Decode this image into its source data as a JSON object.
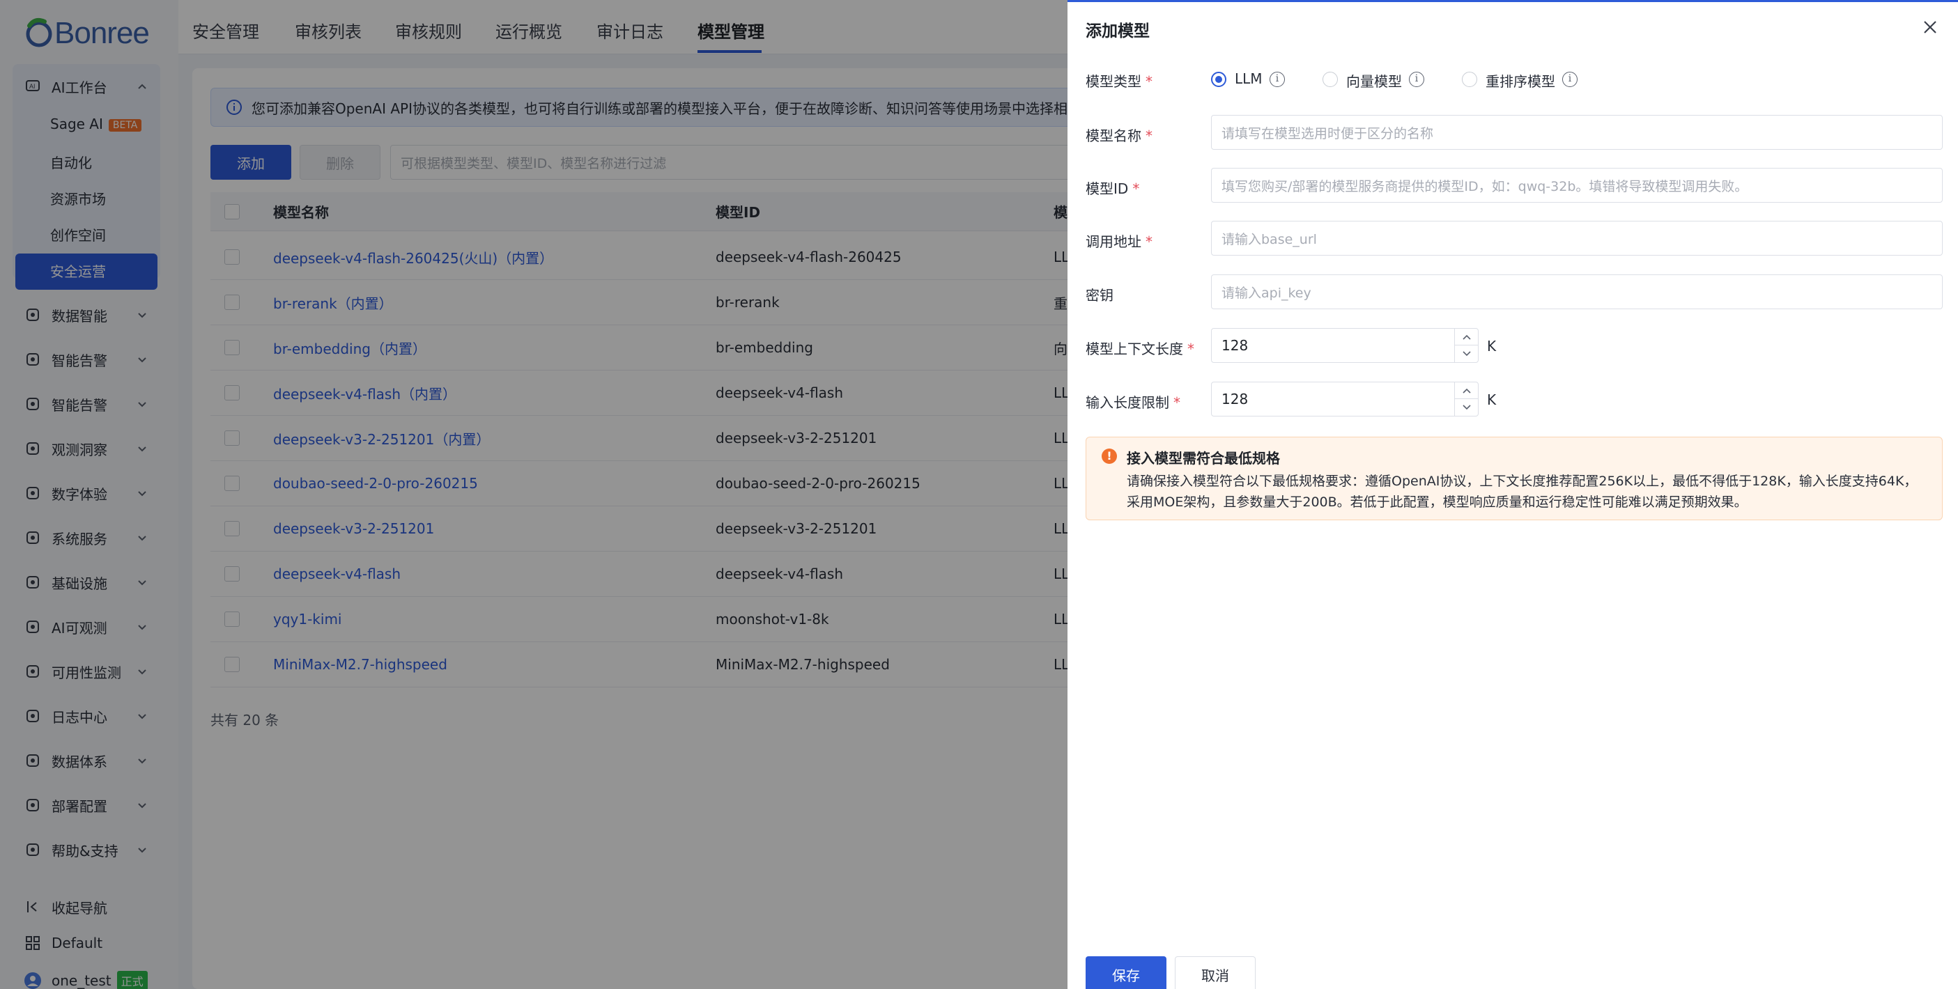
{
  "brand": {
    "logo_text": "Bonree"
  },
  "top_tabs": [
    {
      "label": "安全管理"
    },
    {
      "label": "审核列表"
    },
    {
      "label": "审核规则"
    },
    {
      "label": "运行概览"
    },
    {
      "label": "审计日志"
    },
    {
      "label": "模型管理",
      "active": true
    }
  ],
  "sidebar": {
    "ai_workbench": {
      "label": "AI工作台",
      "icon": "ai-workbench-icon"
    },
    "sub_items": [
      {
        "label": "Sage AI",
        "badge": "BETA"
      },
      {
        "label": "自动化"
      },
      {
        "label": "资源市场"
      },
      {
        "label": "创作空间"
      },
      {
        "label": "安全运营",
        "active": true
      }
    ],
    "groups": [
      {
        "label": "数据智能",
        "icon": "data-intelligence-icon"
      },
      {
        "label": "智能告警",
        "icon": "smart-alert-icon"
      },
      {
        "label": "智能告警",
        "icon": "smart-alert-icon"
      },
      {
        "label": "观测洞察",
        "icon": "observe-insight-icon"
      },
      {
        "label": "数字体验",
        "icon": "digital-experience-icon"
      },
      {
        "label": "系统服务",
        "icon": "system-service-icon"
      },
      {
        "label": "基础设施",
        "icon": "infrastructure-icon"
      },
      {
        "label": "AI可观测",
        "icon": "ai-observability-icon"
      },
      {
        "label": "可用性监测",
        "icon": "availability-monitor-icon"
      },
      {
        "label": "日志中心",
        "icon": "log-center-icon"
      },
      {
        "label": "数据体系",
        "icon": "data-system-icon"
      },
      {
        "label": "部署配置",
        "icon": "deploy-config-icon"
      },
      {
        "label": "帮助&支持",
        "icon": "help-support-icon"
      }
    ],
    "collapse_label": "收起导航",
    "workspace_label": "Default",
    "user": {
      "name": "one_test",
      "badge": "正式"
    }
  },
  "main": {
    "info_text": "您可添加兼容OpenAI API协议的各类模型，也可将自行训练或部署的模型接入平台，便于在故障诊断、知识问答等使用场景中选择相",
    "add_button": "添加",
    "delete_button": "删除",
    "filter_placeholder": "可根据模型类型、模型ID、模型名称进行过滤",
    "columns": [
      "模型名称",
      "模型ID",
      "模"
    ],
    "rows": [
      {
        "name": "deepseek-v4-flash-260425(火山)（内置）",
        "id": "deepseek-v4-flash-260425",
        "type": "LL"
      },
      {
        "name": "br-rerank（内置）",
        "id": "br-rerank",
        "type": "重"
      },
      {
        "name": "br-embedding（内置）",
        "id": "br-embedding",
        "type": "向"
      },
      {
        "name": "deepseek-v4-flash（内置）",
        "id": "deepseek-v4-flash",
        "type": "LL"
      },
      {
        "name": "deepseek-v3-2-251201（内置）",
        "id": "deepseek-v3-2-251201",
        "type": "LL"
      },
      {
        "name": "doubao-seed-2-0-pro-260215",
        "id": "doubao-seed-2-0-pro-260215",
        "type": "LL"
      },
      {
        "name": "deepseek-v3-2-251201",
        "id": "deepseek-v3-2-251201",
        "type": "LL"
      },
      {
        "name": "deepseek-v4-flash",
        "id": "deepseek-v4-flash",
        "type": "LL"
      },
      {
        "name": "yqy1-kimi",
        "id": "moonshot-v1-8k",
        "type": "LL"
      },
      {
        "name": "MiniMax-M2.7-highspeed",
        "id": "MiniMax-M2.7-highspeed",
        "type": "LL"
      }
    ],
    "total_text": "共有 20 条"
  },
  "drawer": {
    "title": "添加模型",
    "model_type": {
      "label": "模型类型",
      "options": [
        {
          "label": "LLM",
          "checked": true
        },
        {
          "label": "向量模型",
          "checked": false
        },
        {
          "label": "重排序模型",
          "checked": false
        }
      ]
    },
    "model_name": {
      "label": "模型名称",
      "placeholder": "请填写在模型选用时便于区分的名称"
    },
    "model_id": {
      "label": "模型ID",
      "placeholder": "填写您购买/部署的模型服务商提供的模型ID，如：qwq-32b。填错将导致模型调用失败。"
    },
    "base_url": {
      "label": "调用地址",
      "placeholder": "请输入base_url"
    },
    "api_key": {
      "label": "密钥",
      "placeholder": "请输入api_key"
    },
    "context_length": {
      "label": "模型上下文长度",
      "value": "128",
      "unit": "K"
    },
    "input_limit": {
      "label": "输入长度限制",
      "value": "128",
      "unit": "K"
    },
    "warning": {
      "title": "接入模型需符合最低规格",
      "text": "请确保接入模型符合以下最低规格要求：遵循OpenAI协议，上下文长度推荐配置256K以上，最低不得低于128K，输入长度支持64K，采用MOE架构，且参数量大于200B。若低于此配置，模型响应质量和运行稳定性可能难以满足预期效果。"
    },
    "save_button": "保存",
    "cancel_button": "取消"
  },
  "colors": {
    "primary": "#2e5bd8",
    "warning": "#f0702d",
    "required": "#e34d59",
    "badge_green": "#2cb84d"
  }
}
